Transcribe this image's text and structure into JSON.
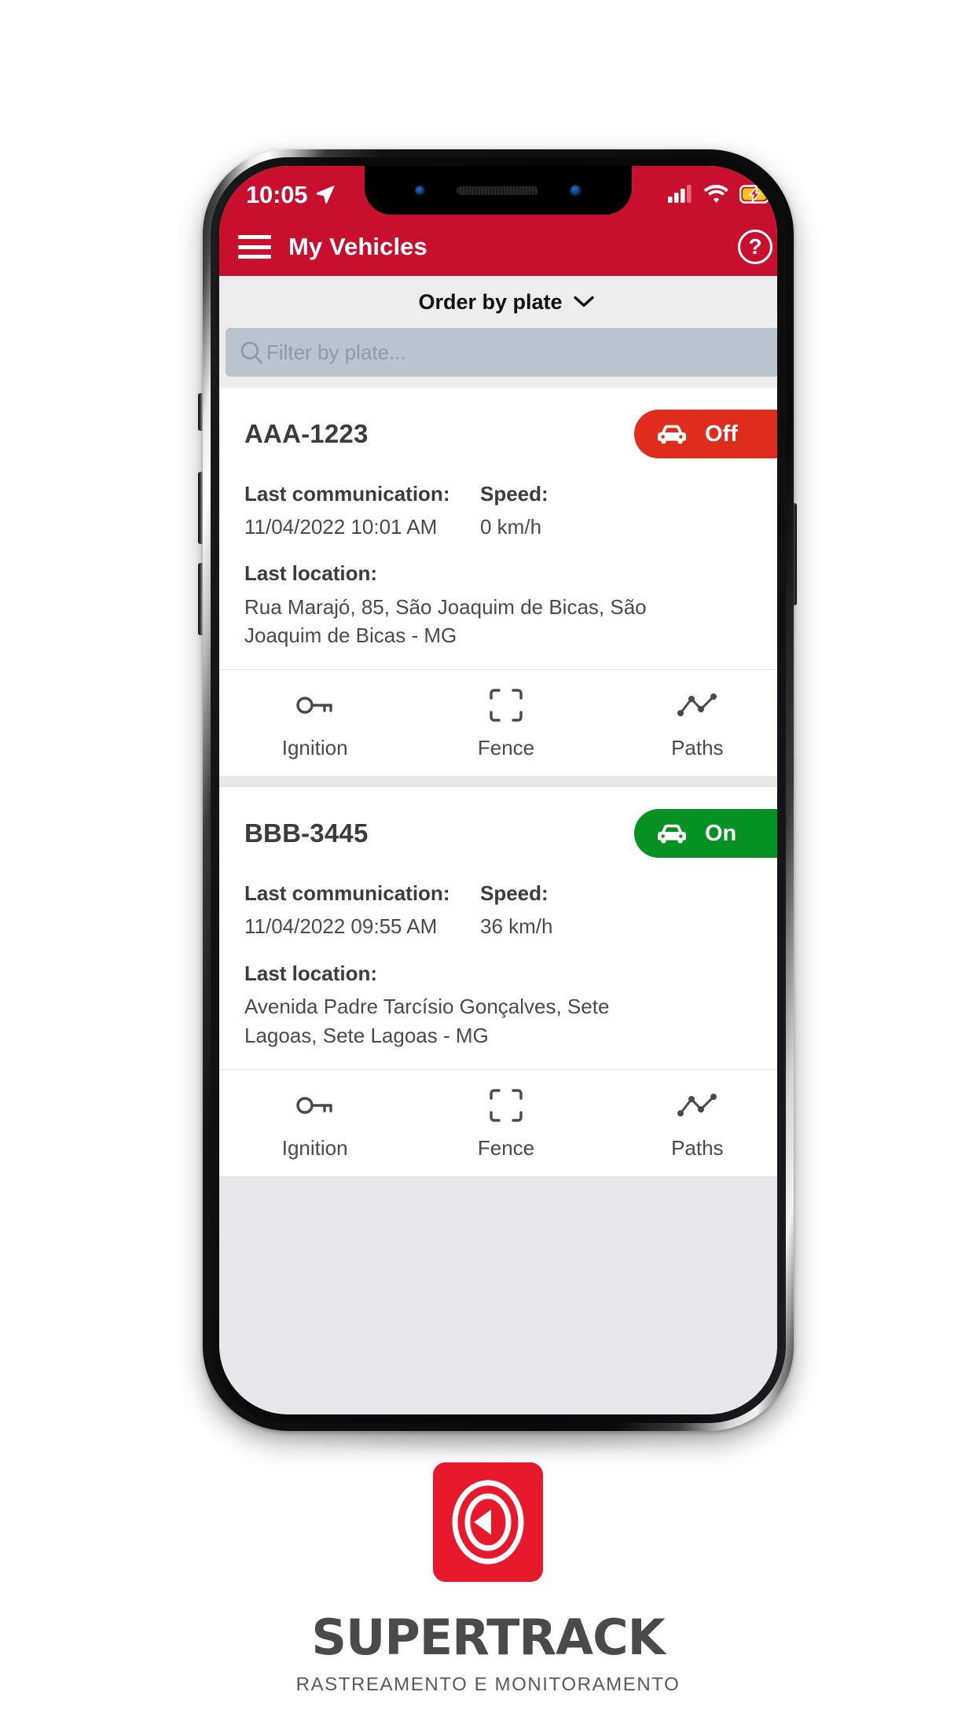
{
  "status_bar": {
    "time": "10:05",
    "location_arrow_icon": "location-arrow-icon",
    "signal_icon": "cellular-signal-icon",
    "wifi_icon": "wifi-icon",
    "battery_icon": "battery-charging-icon"
  },
  "app_bar": {
    "menu_icon": "hamburger-menu-icon",
    "title": "My Vehicles",
    "help_icon": "help-question-icon",
    "help_glyph": "?"
  },
  "sort_bar": {
    "label": "Order by plate",
    "chevron_icon": "chevron-down-icon"
  },
  "search": {
    "icon": "search-icon",
    "placeholder": "Filter by plate...",
    "value": ""
  },
  "labels": {
    "last_communication": "Last communication:",
    "speed": "Speed:",
    "last_location": "Last location:"
  },
  "actions": [
    {
      "label": "Ignition",
      "icon": "key-icon"
    },
    {
      "label": "Fence",
      "icon": "fence-brackets-icon"
    },
    {
      "label": "Paths",
      "icon": "paths-line-chart-icon"
    }
  ],
  "vehicles": [
    {
      "plate": "AAA-1223",
      "status": "Off",
      "status_state": "off",
      "status_color": "#E02C1C",
      "status_icon": "car-icon",
      "last_communication": "11/04/2022 10:01 AM",
      "speed": "0 km/h",
      "last_location": "Rua Marajó, 85, São Joaquim de Bicas, São Joaquim de Bicas - MG"
    },
    {
      "plate": "BBB-3445",
      "status": "On",
      "status_state": "on",
      "status_color": "#069223",
      "status_icon": "car-icon",
      "last_communication": "11/04/2022 09:55 AM",
      "speed": "36 km/h",
      "last_location": "Avenida Padre Tarcísio Gonçalves, Sete Lagoas, Sete Lagoas - MG"
    }
  ],
  "brand": {
    "mark_icon": "supertrack-radar-arrow-logo",
    "mark_color": "#E8192C",
    "name": "SUPERTRACK",
    "tagline": "RASTREAMENTO E MONITORAMENTO"
  },
  "theme": {
    "brand_red": "#C8102E",
    "status_on_green": "#069223",
    "status_off_red": "#E02C1C",
    "page_bg": "#E7E7E9",
    "sort_bar_bg": "#EDEDEE",
    "search_bg": "#B9C4CE"
  }
}
